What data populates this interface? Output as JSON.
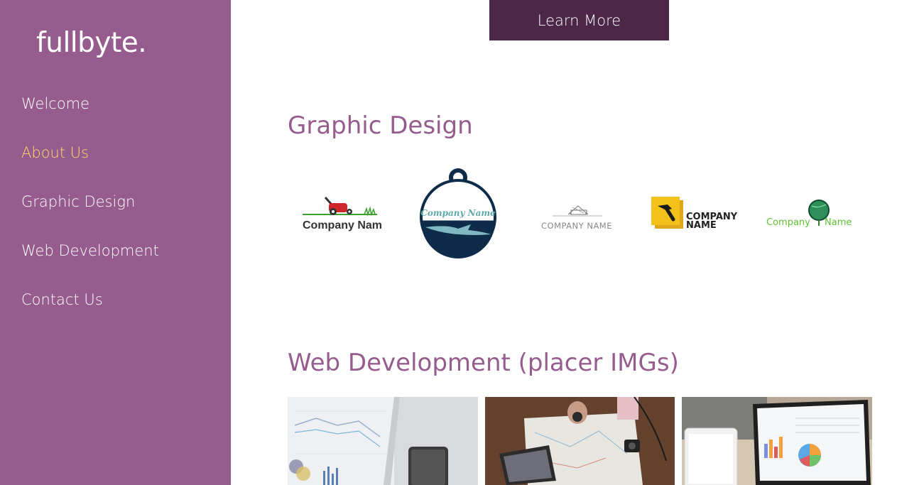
{
  "sidebar": {
    "brand": "fullbyte.",
    "items": [
      {
        "label": "Welcome"
      },
      {
        "label": "About Us"
      },
      {
        "label": "Graphic Design"
      },
      {
        "label": "Web Development"
      },
      {
        "label": "Contact Us"
      }
    ],
    "active_index": 1
  },
  "main": {
    "learn_more": "Learn More",
    "graphic_design": {
      "title": "Graphic Design",
      "logos": [
        {
          "text": "Company Name",
          "icon": "lawnmower-icon"
        },
        {
          "text": "Company Name",
          "icon": "shark-badge-icon"
        },
        {
          "text": "COMPANY NAME",
          "icon": "house-outline-icon"
        },
        {
          "text": "COMPANY",
          "text2": "NAME",
          "icon": "hammer-icon"
        },
        {
          "text": "Company",
          "text2": "Name",
          "icon": "globe-tree-icon"
        }
      ]
    },
    "web_development": {
      "title": "Web Development (placer IMGs)",
      "images": [
        {
          "name": "analytics-paper-phone-photo"
        },
        {
          "name": "map-laptop-desk-photo"
        },
        {
          "name": "laptop-tablet-charts-photo"
        }
      ]
    }
  },
  "colors": {
    "sidebar_bg": "#955c8d",
    "active_nav": "#ffd870",
    "button_bg": "#4d2748",
    "heading": "#955c8d"
  }
}
